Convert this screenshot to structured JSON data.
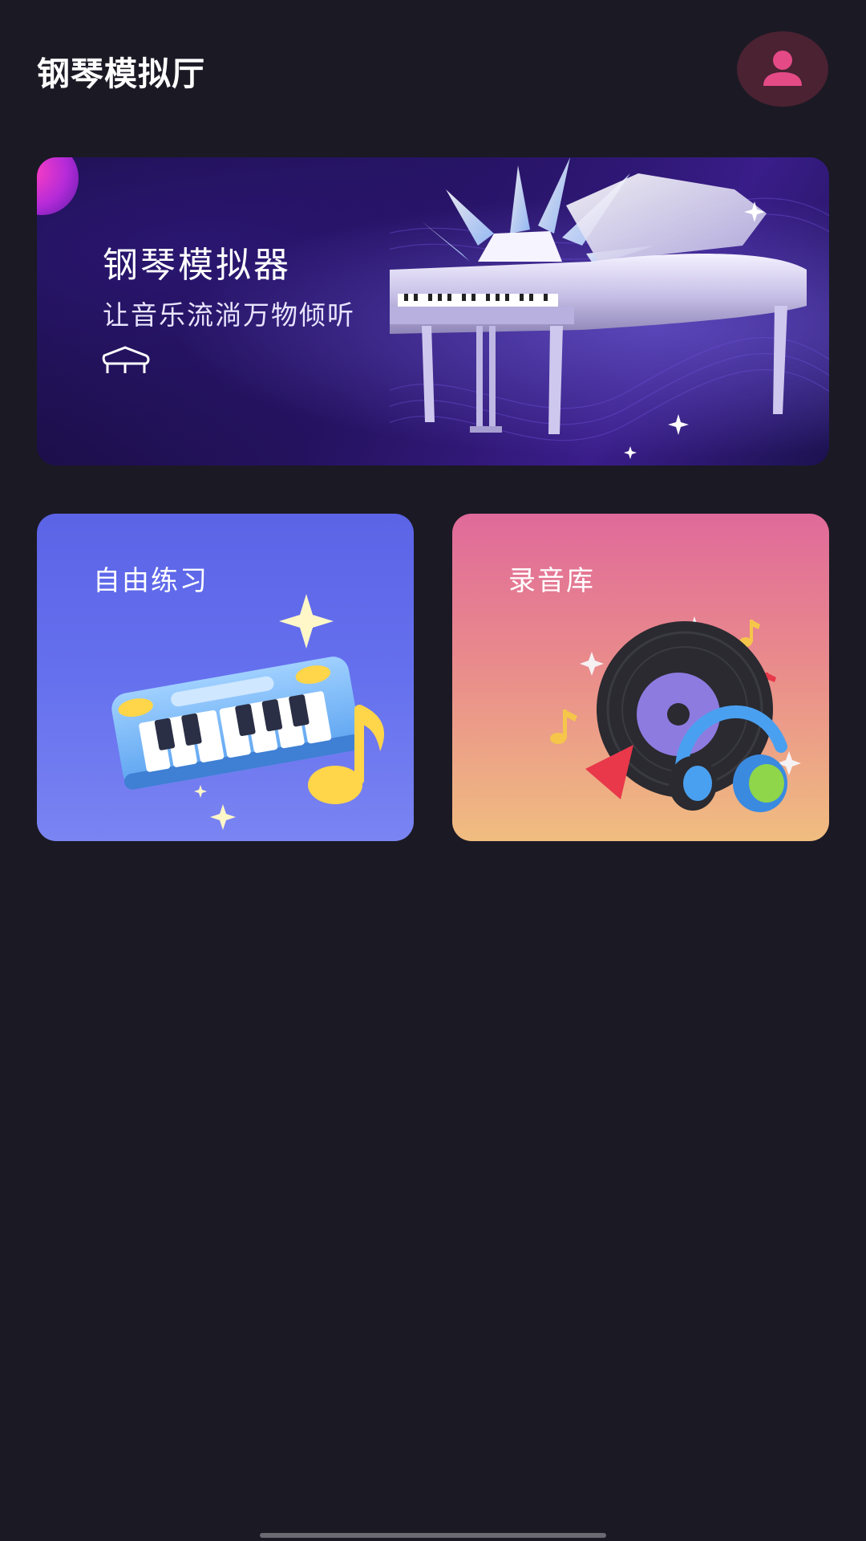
{
  "header": {
    "title": "钢琴模拟厅",
    "avatar_icon": "user-icon"
  },
  "banner": {
    "title": "钢琴模拟器",
    "subtitle": "让音乐流淌万物倾听",
    "icon": "grand-piano-icon"
  },
  "cards": [
    {
      "label": "自由练习",
      "icon": "keyboard-illustration"
    },
    {
      "label": "录音库",
      "icon": "vinyl-headphones-illustration"
    }
  ],
  "colors": {
    "background": "#1b1924",
    "avatar_bg": "#4a2232",
    "avatar_icon": "#e44a86",
    "practice_card": "#6570ee",
    "records_card_top": "#e06a9a",
    "records_card_bottom": "#f0bd80"
  }
}
